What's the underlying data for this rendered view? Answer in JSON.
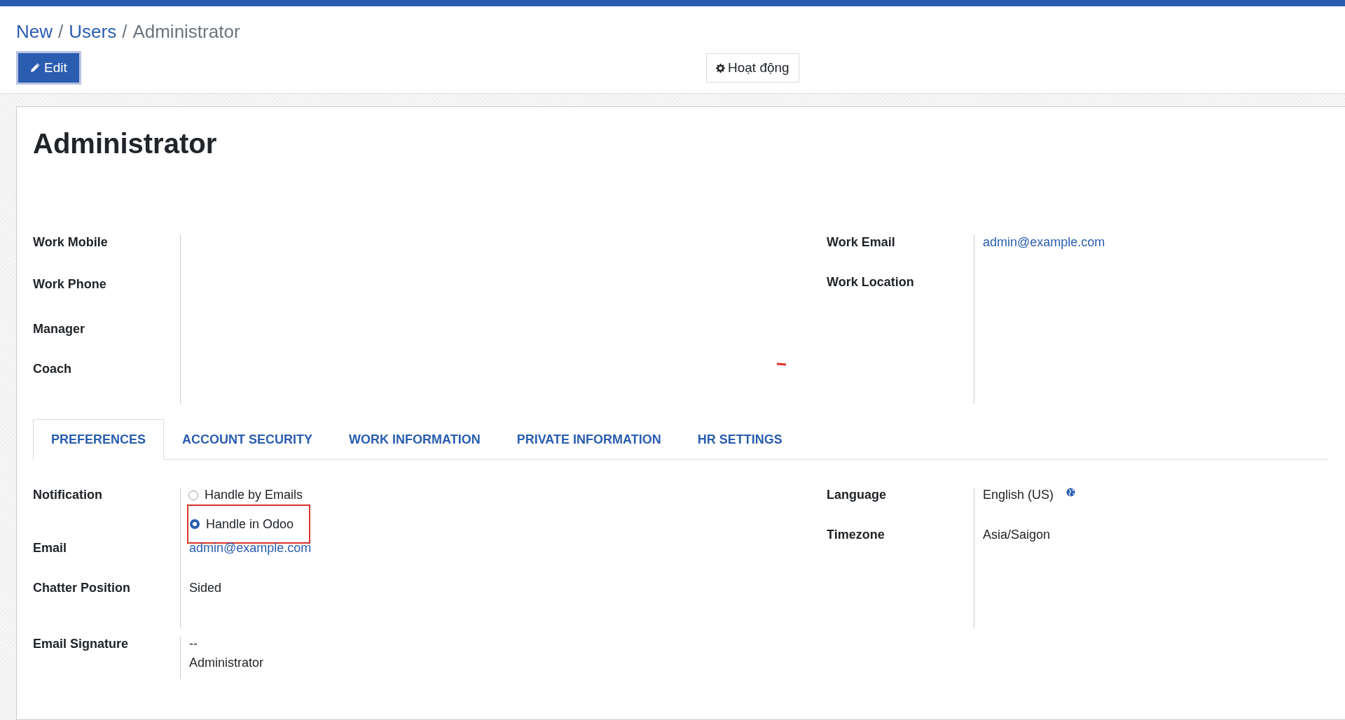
{
  "breadcrumb": [
    {
      "text": "New",
      "kind": "link"
    },
    {
      "text": "Users",
      "kind": "link"
    },
    {
      "text": "Administrator",
      "kind": "current"
    }
  ],
  "breadcrumb_separator": "/",
  "edit_button": {
    "label": "Edit"
  },
  "action_button": {
    "label": "Hoạt động"
  },
  "title": "Administrator",
  "fields_left": [
    {
      "label": "Work Mobile"
    },
    {
      "label": "Work Phone"
    },
    {
      "label": "Manager"
    },
    {
      "label": "Coach"
    }
  ],
  "fields_right": [
    {
      "label": "Work Email",
      "value": "admin@example.com",
      "kind": "link"
    },
    {
      "label": "Work Location"
    }
  ],
  "tabs": [
    {
      "label": "PREFERENCES",
      "selected": true
    },
    {
      "label": "ACCOUNT SECURITY",
      "selected": false
    },
    {
      "label": "WORK INFORMATION",
      "selected": false
    },
    {
      "label": "PRIVATE INFORMATION",
      "selected": false
    },
    {
      "label": "HR SETTINGS",
      "selected": false
    }
  ],
  "preferences_left": [
    {
      "label": "Notification",
      "kind": "radio",
      "options": [
        {
          "label": "Handle by Emails",
          "selected": false,
          "highlighted": false
        },
        {
          "label": "Handle in Odoo",
          "selected": true,
          "highlighted": true
        }
      ]
    },
    {
      "label": "Email",
      "kind": "link",
      "value": "admin@example.com"
    },
    {
      "label": "Chatter Position",
      "kind": "text",
      "value": "Sided"
    }
  ],
  "signature": {
    "label": "Email Signature",
    "lines": [
      "--",
      "Administrator"
    ]
  },
  "preferences_right": [
    {
      "label": "Language",
      "value": "English (US)",
      "kind": "language"
    },
    {
      "label": "Timezone",
      "value": "Asia/Saigon",
      "kind": "text"
    }
  ]
}
